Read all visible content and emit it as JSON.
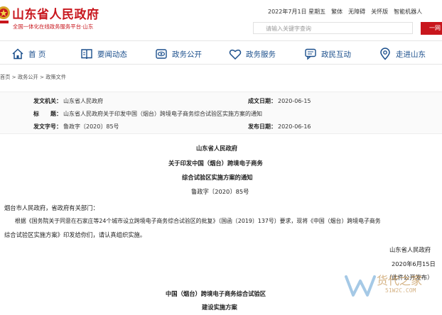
{
  "header": {
    "site_name": "山东省人民政府",
    "slogan": "全国一体化在线政务服务平台·山东",
    "date": "2022年7月1日 星期五",
    "links": [
      "繁体",
      "无障碍",
      "关怀版",
      "智能机器人"
    ],
    "search_placeholder": "请输入关键字查询",
    "search_button": "一网"
  },
  "nav": [
    {
      "label": "首 页",
      "icon": "home-icon"
    },
    {
      "label": "要闻动态",
      "icon": "book-icon"
    },
    {
      "label": "政务公开",
      "icon": "eye-icon"
    },
    {
      "label": "政务服务",
      "icon": "heart-icon"
    },
    {
      "label": "政民互动",
      "icon": "chat-icon"
    },
    {
      "label": "走进山东",
      "icon": "location-icon"
    }
  ],
  "breadcrumb": "首页 > 政务公开 > 政策文件",
  "meta": {
    "issuer_label": "发文机关：",
    "issuer": "山东省人民政府",
    "established_label": "成文日期：",
    "established": "2020-06-15",
    "title_label": "标　　题：",
    "title": "山东省人民政府关于印发中国（烟台）跨境电子商务综合试验区实施方案的通知",
    "docno_label": "发文字号：",
    "docno": "鲁政字〔2020〕85号",
    "published_label": "发布日期：",
    "published": "2020-06-16"
  },
  "document": {
    "issuer_title": "山东省人民政府",
    "title_line1": "关于印发中国（烟台）跨境电子商务",
    "title_line2": "综合试验区实施方案的通知",
    "docno": "鲁政字〔2020〕85号",
    "salutation": "烟台市人民政府，省政府有关部门：",
    "body_line1": "根据《国务院关于同意在石家庄等24个城市设立跨境电子商务综合试验区的批复》（国函〔2019〕137号）要求，现将《中国（烟台）跨境电子商务",
    "body_line2": "综合试验区实施方案》印发给你们，请认真组织实施。",
    "signature": "山东省人民政府",
    "date": "2020年6月15日",
    "publicity_note": "（此件公开发布）",
    "plan_title_line1": "中国（烟台）跨境电子商务综合试验区",
    "plan_title_line2": "建设实施方案"
  },
  "watermark": {
    "text": "货代之家",
    "url": "51W2C.COM"
  },
  "colors": {
    "brand_red": "#c8161d",
    "nav_blue": "#1b4f8c",
    "watermark": "#c79a5d"
  }
}
